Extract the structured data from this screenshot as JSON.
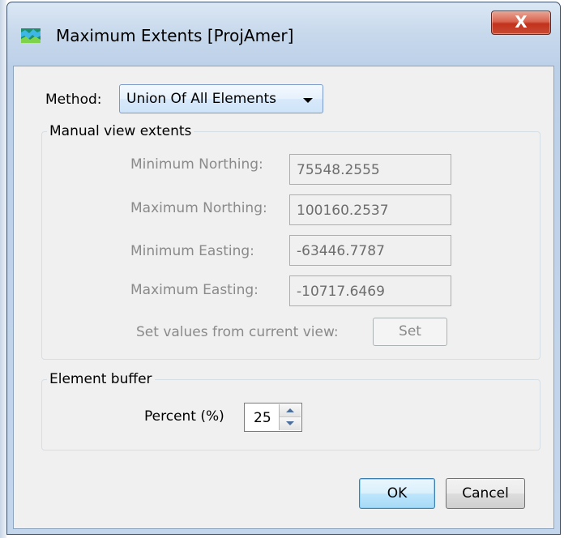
{
  "window": {
    "title": "Maximum Extents [ProjAmer]",
    "close_label": "X"
  },
  "method": {
    "label": "Method:",
    "selected": "Union Of All Elements"
  },
  "manual_view_extents": {
    "title": "Manual view extents",
    "fields": [
      {
        "label": "Minimum Northing:",
        "value": "75548.2555"
      },
      {
        "label": "Maximum Northing:",
        "value": "100160.2537"
      },
      {
        "label": "Minimum Easting:",
        "value": "-63446.7787"
      },
      {
        "label": "Maximum Easting:",
        "value": "-10717.6469"
      }
    ],
    "set_values_label": "Set values from current view:",
    "set_button": "Set"
  },
  "element_buffer": {
    "title": "Element buffer",
    "percent_label": "Percent (%)",
    "percent_value": "25"
  },
  "buttons": {
    "ok": "OK",
    "cancel": "Cancel"
  },
  "colors": {
    "titlebar": "#c7d8ec",
    "close_button": "#c84b33",
    "dialog_background": "#f0f0f0",
    "disabled_text": "#8a8a8a"
  }
}
